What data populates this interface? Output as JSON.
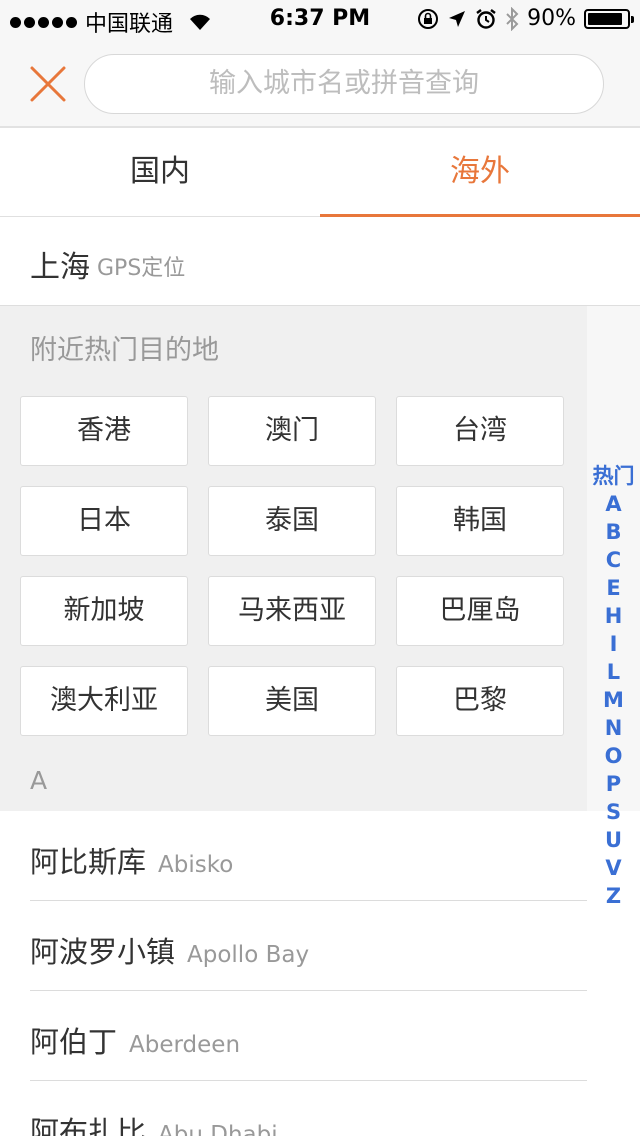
{
  "status_bar": {
    "carrier": "中国联通",
    "time": "6:37 PM",
    "battery": "90%",
    "battery_level": 0.9
  },
  "search": {
    "placeholder": "输入城市名或拼音查询"
  },
  "tabs": [
    {
      "label": "国内",
      "active": false
    },
    {
      "label": "海外",
      "active": true
    }
  ],
  "gps": {
    "city": "上海",
    "tag": "GPS定位"
  },
  "hot": {
    "title": "附近热门目的地",
    "items": [
      "香港",
      "澳门",
      "台湾",
      "日本",
      "泰国",
      "韩国",
      "新加坡",
      "马来西亚",
      "巴厘岛",
      "澳大利亚",
      "美国",
      "巴黎"
    ]
  },
  "index": [
    "热门",
    "A",
    "B",
    "C",
    "E",
    "H",
    "I",
    "L",
    "M",
    "N",
    "O",
    "P",
    "S",
    "U",
    "V",
    "Z"
  ],
  "section_a": {
    "letter": "A",
    "cities": [
      {
        "cn": "阿比斯库",
        "en": "Abisko"
      },
      {
        "cn": "阿波罗小镇",
        "en": "Apollo Bay"
      },
      {
        "cn": "阿伯丁",
        "en": "Aberdeen"
      },
      {
        "cn": "阿布扎比",
        "en": "Abu Dhabi"
      }
    ]
  },
  "colors": {
    "accent": "#e8773b",
    "index": "#3a6fd4"
  }
}
